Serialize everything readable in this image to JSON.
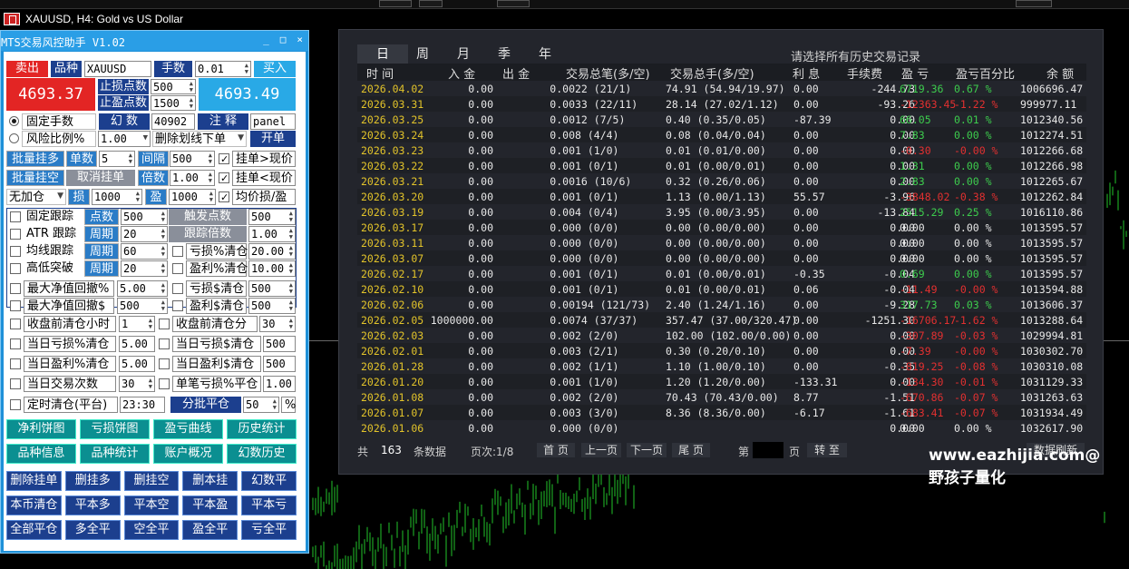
{
  "chart": {
    "title": "XAUUSD, H4:  Gold vs US Dollar"
  },
  "panel": {
    "title": "MTS交易风控助手 V1.02",
    "win_buttons": [
      "_",
      "□",
      "×"
    ],
    "sell_label": "卖出",
    "buy_label": "买入",
    "symbol_label": "品种",
    "symbol_value": "XAUUSD",
    "lots_label": "手数",
    "lots_value": "0.01",
    "sell_price": "4693.37",
    "buy_price": "4693.49",
    "sl_points_label": "止损点数",
    "sl_points_value": "500",
    "tp_points_label": "止盈点数",
    "tp_points_value": "1500",
    "fixed_lots_label": "固定手数",
    "magic_label": "幻 数",
    "magic_value": "40902",
    "comment_label": "注 释",
    "comment_value": "panel",
    "risk_label": "风险比例%",
    "risk_value": "1.00",
    "delete_line_label": "删除划线下单",
    "open_label": "开单",
    "batch_long_label": "批量挂多",
    "count_label": "单数",
    "count_value": "5",
    "interval_label": "间隔",
    "interval_value": "500",
    "pend_above_label": "挂单>现价",
    "batch_short_label": "批量挂空",
    "cancel_pend_label": "取消挂单",
    "multiple_label": "倍数",
    "multiple_value": "1.00",
    "pend_below_label": "挂单<现价",
    "no_add_label": "无加仓",
    "sl_short_label": "损",
    "sl_short_value": "1000",
    "tp_short_label": "盈",
    "tp_short_value": "1000",
    "avg_label": "均价损/盈",
    "fixed_trail_label": "固定跟踪",
    "points_label": "点数",
    "points_value": "500",
    "trigger_label": "触发点数",
    "trigger_value": "500",
    "atr_trail_label": "ATR 跟踪",
    "period_label": "周期",
    "atr_period_value": "20",
    "trail_mult_label": "跟踪倍数",
    "trail_mult_value": "1.00",
    "ma_trail_label": "均线跟踪",
    "ma_period_value": "60",
    "loss_pct_close_label": "亏损%清仓",
    "loss_pct_close_value": "20.00",
    "hl_break_label": "高低突破",
    "hl_period_value": "20",
    "profit_pct_close_label": "盈利%清仓",
    "profit_pct_close_value": "10.00",
    "max_eq_pct_label": "最大净值回撤%",
    "max_eq_pct_value": "5.00",
    "loss_usd_close_label": "亏损$清仓",
    "loss_usd_close_value": "500",
    "max_eq_usd_label": "最大净值回撤$",
    "max_eq_usd_value": "500",
    "profit_usd_close_label": "盈利$清仓",
    "profit_usd_close_value": "500",
    "pre_close_hours_label": "收盘前清仓小时",
    "pre_close_hours_value": "1",
    "pre_close_min_label": "收盘前清仓分",
    "pre_close_min_value": "30",
    "daily_loss_pct_label": "当日亏损%清仓",
    "daily_loss_pct_value": "5.00",
    "daily_loss_usd_label": "当日亏损$清仓",
    "daily_loss_usd_value": "500",
    "daily_profit_pct_label": "当日盈利%清仓",
    "daily_profit_pct_value": "5.00",
    "daily_profit_usd_label": "当日盈利$清仓",
    "daily_profit_usd_value": "500",
    "daily_trades_label": "当日交易次数",
    "daily_trades_value": "30",
    "single_loss_label": "单笔亏损%平仓",
    "single_loss_value": "1.00",
    "timed_close_label": "定时清仓(平台)",
    "timed_close_value": "23:30",
    "partial_close_label": "分批平仓",
    "partial_close_value": "50",
    "pct_sign": "%",
    "btn_rows": [
      [
        "净利饼图",
        "亏损饼图",
        "盈亏曲线",
        "历史统计"
      ],
      [
        "品种信息",
        "品种统计",
        "账户概况",
        "幻数历史"
      ],
      [
        "删除挂单",
        "删挂多",
        "删挂空",
        "删本挂",
        "幻数平"
      ],
      [
        "本币清仓",
        "平本多",
        "平本空",
        "平本盈",
        "平本亏"
      ],
      [
        "全部平仓",
        "多全平",
        "空全平",
        "盈全平",
        "亏全平"
      ]
    ]
  },
  "history": {
    "tabs": [
      "日",
      "周",
      "月",
      "季",
      "年"
    ],
    "hint": "请选择所有历史交易记录",
    "headers": [
      "时 间",
      "入 金",
      "出 金",
      "交易总笔(多/空)",
      "交易总手(多/空)",
      "利 息",
      "手续费",
      "盈 亏",
      "盈亏百分比",
      "余 额"
    ],
    "rows": [
      [
        "2026.04.02",
        "0.00",
        "0.00",
        "22  (21/1)",
        "74.91  (54.94/19.97)",
        "0.00",
        "-244.73",
        "6719.36",
        "0.67 %",
        "1006696.47",
        "pos"
      ],
      [
        "2026.03.31",
        "0.00",
        "0.00",
        "33  (22/11)",
        "28.14  (27.02/1.12)",
        "0.00",
        "-93.26",
        "-12363.45",
        "-1.22 %",
        "999977.11",
        "neg"
      ],
      [
        "2026.03.25",
        "0.00",
        "0.00",
        "12  (7/5)",
        "0.40  (0.35/0.05)",
        "-87.39",
        "0.00",
        "66.05",
        "0.01 %",
        "1012340.56",
        "pos"
      ],
      [
        "2026.03.24",
        "0.00",
        "0.00",
        "8  (4/4)",
        "0.08  (0.04/0.04)",
        "0.00",
        "0.00",
        "7.83",
        "0.00 %",
        "1012274.51",
        "pos"
      ],
      [
        "2026.03.23",
        "0.00",
        "0.00",
        "1  (1/0)",
        "0.01  (0.01/0.00)",
        "0.00",
        "0.00",
        "-0.30",
        "-0.00 %",
        "1012266.68",
        "neg"
      ],
      [
        "2026.03.22",
        "0.00",
        "0.00",
        "1  (0/1)",
        "0.01  (0.00/0.01)",
        "0.00",
        "0.00",
        "1.31",
        "0.00 %",
        "1012266.98",
        "pos"
      ],
      [
        "2026.03.21",
        "0.00",
        "0.00",
        "16  (10/6)",
        "0.32  (0.26/0.06)",
        "0.00",
        "0.00",
        "2.83",
        "0.00 %",
        "1012265.67",
        "pos"
      ],
      [
        "2026.03.20",
        "0.00",
        "0.00",
        "1  (0/1)",
        "1.13  (0.00/1.13)",
        "55.57",
        "-3.96",
        "-3848.02",
        "-0.38 %",
        "1012262.84",
        "neg"
      ],
      [
        "2026.03.19",
        "0.00",
        "0.00",
        "4  (0/4)",
        "3.95  (0.00/3.95)",
        "0.00",
        "-13.84",
        "2515.29",
        "0.25 %",
        "1016110.86",
        "pos"
      ],
      [
        "2026.03.17",
        "0.00",
        "0.00",
        "0  (0/0)",
        "0.00  (0.00/0.00)",
        "0.00",
        "0.00",
        "0.00",
        "0.00 %",
        "1013595.57",
        "neu"
      ],
      [
        "2026.03.11",
        "0.00",
        "0.00",
        "0  (0/0)",
        "0.00  (0.00/0.00)",
        "0.00",
        "0.00",
        "0.00",
        "0.00 %",
        "1013595.57",
        "neu"
      ],
      [
        "2026.03.07",
        "0.00",
        "0.00",
        "0  (0/0)",
        "0.00  (0.00/0.00)",
        "0.00",
        "0.00",
        "0.00",
        "0.00 %",
        "1013595.57",
        "neu"
      ],
      [
        "2026.02.17",
        "0.00",
        "0.00",
        "1  (0/1)",
        "0.01  (0.00/0.01)",
        "-0.35",
        "-0.04",
        "0.69",
        "0.00 %",
        "1013595.57",
        "pos"
      ],
      [
        "2026.02.10",
        "0.00",
        "0.00",
        "1  (0/1)",
        "0.01  (0.00/0.01)",
        "0.06",
        "-0.04",
        "-11.49",
        "-0.00 %",
        "1013594.88",
        "neg"
      ],
      [
        "2026.02.06",
        "0.00",
        "0.00",
        "194  (121/73)",
        "2.40  (1.24/1.16)",
        "0.00",
        "-9.28",
        "317.73",
        "0.03 %",
        "1013606.37",
        "pos"
      ],
      [
        "2026.02.05",
        "1000000.00",
        "0.00",
        "74  (37/37)",
        "357.47  (37.00/320.47)",
        "0.00",
        "-1251.30",
        "-16706.17",
        "-1.62 %",
        "1013288.64",
        "neg"
      ],
      [
        "2026.02.03",
        "0.00",
        "0.00",
        "2  (2/0)",
        "102.00  (102.00/0.00)",
        "0.00",
        "0.00",
        "-307.89",
        "-0.03 %",
        "1029994.81",
        "neg"
      ],
      [
        "2026.02.01",
        "0.00",
        "0.00",
        "3  (2/1)",
        "0.30  (0.20/0.10)",
        "0.00",
        "0.00",
        "-7.39",
        "-0.00 %",
        "1030302.70",
        "neg"
      ],
      [
        "2026.01.28",
        "0.00",
        "0.00",
        "2  (1/1)",
        "1.10  (1.00/0.10)",
        "0.00",
        "-0.35",
        "-819.25",
        "-0.08 %",
        "1030310.08",
        "neg"
      ],
      [
        "2026.01.20",
        "0.00",
        "0.00",
        "1  (1/0)",
        "1.20  (1.20/0.00)",
        "-133.31",
        "0.00",
        "-134.30",
        "-0.01 %",
        "1031129.33",
        "neg"
      ],
      [
        "2026.01.08",
        "0.00",
        "0.00",
        "2  (2/0)",
        "70.43  (70.43/0.00)",
        "8.77",
        "-1.51",
        "-670.86",
        "-0.07 %",
        "1031263.63",
        "neg"
      ],
      [
        "2026.01.07",
        "0.00",
        "0.00",
        "3  (3/0)",
        "8.36  (8.36/0.00)",
        "-6.17",
        "-1.61",
        "-683.41",
        "-0.07 %",
        "1031934.49",
        "neg"
      ],
      [
        "2026.01.06",
        "0.00",
        "0.00",
        "0  (0/0)",
        "",
        "",
        "0.00",
        "0.00",
        "0.00 %",
        "1032617.90",
        "neu"
      ]
    ],
    "footer": {
      "total_label": "共",
      "total_count": "163",
      "records_label": "条数据",
      "page_label": "页次:1/8",
      "first": "首 页",
      "prev": "上一页",
      "next": "下一页",
      "last": "尾 页",
      "goto_pre": "第",
      "goto_post": "页",
      "goto_btn": "转 至",
      "refresh": "数据刷新"
    },
    "watermark": "www.eazhijia.com@野孩子量化"
  }
}
